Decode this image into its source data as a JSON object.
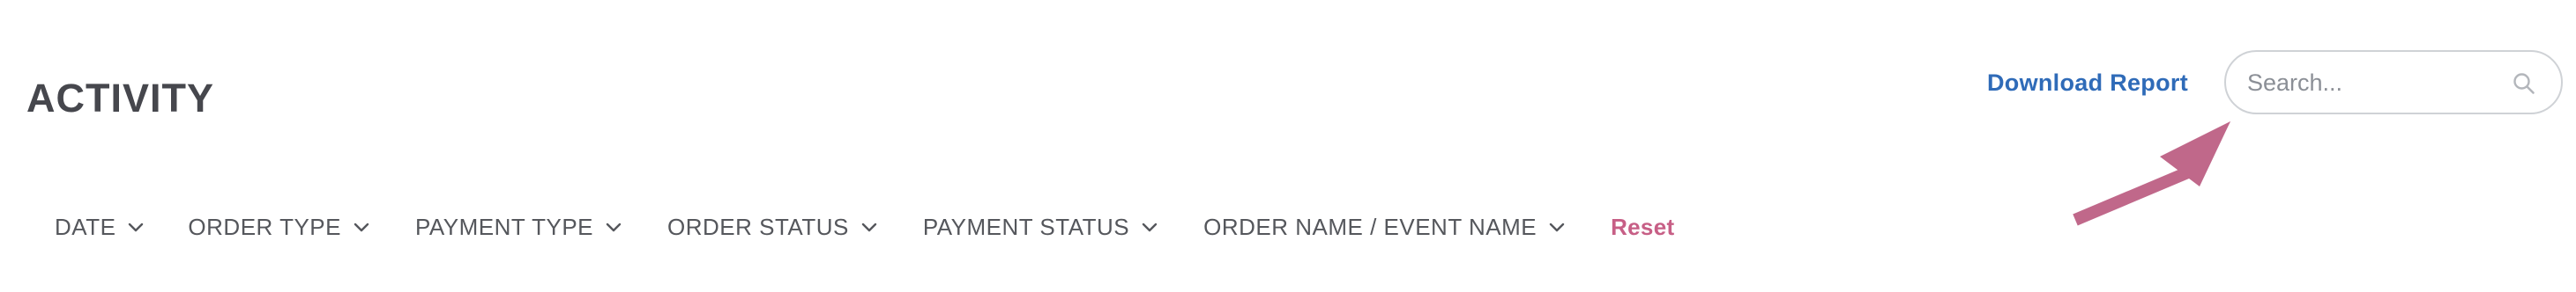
{
  "header": {
    "title": "ACTIVITY",
    "download_label": "Download Report"
  },
  "search": {
    "placeholder": "Search...",
    "value": ""
  },
  "filters": [
    {
      "label": "DATE"
    },
    {
      "label": "ORDER TYPE"
    },
    {
      "label": "PAYMENT TYPE"
    },
    {
      "label": "ORDER STATUS"
    },
    {
      "label": "PAYMENT STATUS"
    },
    {
      "label": "ORDER NAME / EVENT NAME"
    }
  ],
  "reset_label": "Reset",
  "icons": {
    "search": "search-icon",
    "chevron": "chevron-down-icon",
    "annotation": "arrow-annotation"
  },
  "colors": {
    "title": "#46474d",
    "link": "#2f6bb8",
    "reset": "#c75f86",
    "arrow": "#c0688a",
    "filter_text": "#55575c",
    "search_border": "#cfd2d6"
  }
}
